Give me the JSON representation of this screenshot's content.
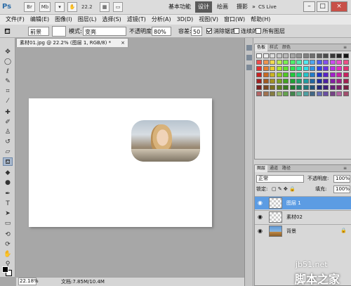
{
  "titlebar": {
    "logo": "Ps",
    "btn_br": "Br",
    "btn_mb": "Mb",
    "zoom_value": "22.2",
    "workspaces": [
      "基本功能",
      "设计",
      "绘画",
      "摄影"
    ],
    "more": "»",
    "cslive": "CS Live",
    "min": "–",
    "max": "□",
    "close": "×"
  },
  "menu": {
    "items": [
      "文件(F)",
      "编辑(E)",
      "图像(I)",
      "图层(L)",
      "选择(S)",
      "滤镜(T)",
      "分析(A)",
      "3D(D)",
      "视图(V)",
      "窗口(W)",
      "帮助(H)"
    ]
  },
  "options": {
    "preset": "前景",
    "mode_label": "模式:",
    "mode_value": "变亮",
    "opacity_label": "不透明度:",
    "opacity_value": "80%",
    "tolerance_label": "容差:",
    "tolerance_value": "50",
    "antialias_label": "消除锯齿",
    "antialias_checked": true,
    "contiguous_label": "连续的",
    "contiguous_checked": false,
    "alllayers_label": "所有图层",
    "alllayers_checked": false
  },
  "tools": [
    "move-icon",
    "marquee-icon",
    "lasso-icon",
    "quick-select-icon",
    "crop-icon",
    "eyedropper-icon",
    "healing-icon",
    "brush-icon",
    "clone-icon",
    "history-brush-icon",
    "eraser-icon",
    "paint-bucket-icon",
    "blur-icon",
    "dodge-icon",
    "pen-icon",
    "type-icon",
    "path-select-icon",
    "shape-icon",
    "3d-rotate-icon",
    "3d-orbit-icon",
    "hand-icon",
    "zoom-icon"
  ],
  "document": {
    "tab_title": "素材01.jpg @ 22.2% (图层 1, RGB/8) *",
    "tab_close": "×"
  },
  "status": {
    "zoom": "22.18%",
    "doc_info": "文档:7.85M/10.4M"
  },
  "swatches_panel": {
    "tabs": [
      "色板",
      "样式",
      "颜色"
    ],
    "active_tab": "色板"
  },
  "layers_panel": {
    "tabs": [
      "图层",
      "通道",
      "路径"
    ],
    "active_tab": "图层",
    "blend_mode": "正常",
    "opacity_label": "不透明度:",
    "opacity_value": "100%",
    "lock_label": "锁定:",
    "fill_label": "填充:",
    "fill_value": "100%",
    "layers": [
      {
        "name": "图层 1",
        "selected": true,
        "thumb": "transparent",
        "locked": false
      },
      {
        "name": "素材02",
        "selected": false,
        "thumb": "transparent",
        "locked": false
      },
      {
        "name": "背景",
        "selected": false,
        "thumb": "image",
        "locked": true
      }
    ]
  },
  "watermark": {
    "site": "jb51.net",
    "brand": "脚本之家"
  },
  "colors": {
    "selected_layer": "#5c9ce3",
    "workspace_active": "#5a5a5a",
    "close_button": "#c85048"
  }
}
